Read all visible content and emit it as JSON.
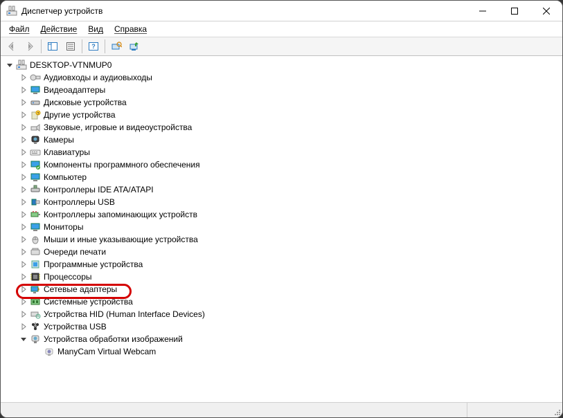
{
  "window": {
    "title": "Диспетчер устройств"
  },
  "menu": {
    "file": "Файл",
    "action": "Действие",
    "view": "Вид",
    "help": "Справка"
  },
  "tree": {
    "root": "DESKTOP-VTNMUP0",
    "items": [
      "Аудиовходы и аудиовыходы",
      "Видеоадаптеры",
      "Дисковые устройства",
      "Другие устройства",
      "Звуковые, игровые и видеоустройства",
      "Камеры",
      "Клавиатуры",
      "Компоненты программного обеспечения",
      "Компьютер",
      "Контроллеры IDE ATA/ATAPI",
      "Контроллеры USB",
      "Контроллеры запоминающих устройств",
      "Мониторы",
      "Мыши и иные указывающие устройства",
      "Очереди печати",
      "Программные устройства",
      "Процессоры",
      "Сетевые адаптеры",
      "Системные устройства",
      "Устройства HID (Human Interface Devices)",
      "Устройства USB",
      "Устройства обработки изображений"
    ],
    "imaging_child": "ManyCam Virtual Webcam"
  }
}
